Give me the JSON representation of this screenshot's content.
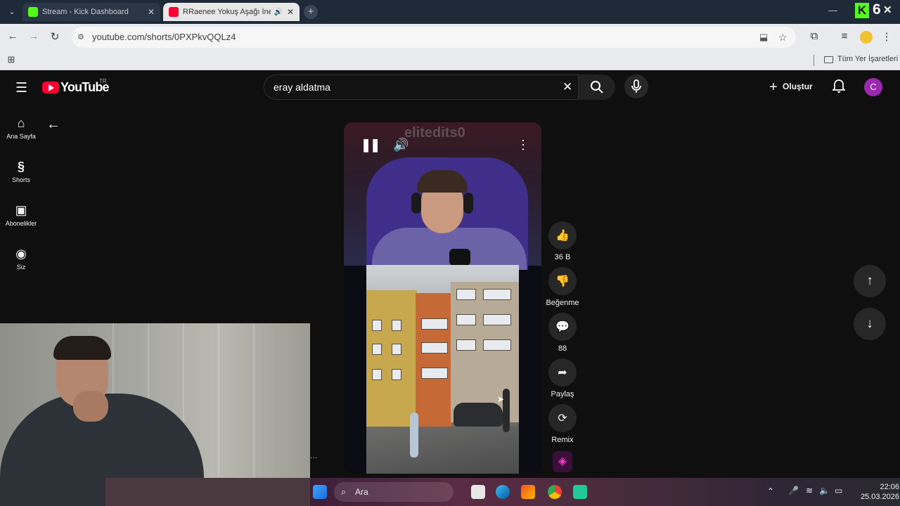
{
  "browser": {
    "tabs": [
      {
        "label": "Stream - Kick Dashboard"
      },
      {
        "label": "RRaenee Yokuş Aşağı İnerk"
      }
    ],
    "url": "youtube.com/shorts/0PXPkvQQLz4",
    "bookmarks_label": "Tüm Yer İşaretleri",
    "overlay_count": "6"
  },
  "youtube": {
    "logo_text": "YouTube",
    "region": "TR",
    "search_value": "eray aldatma",
    "create_label": "Oluştur",
    "avatar_letter": "C",
    "nav": [
      {
        "label": "Ana Sayfa",
        "icon": "home-icon"
      },
      {
        "label": "Shorts",
        "icon": "shorts-icon"
      },
      {
        "label": "Abonelikler",
        "icon": "subscriptions-icon"
      },
      {
        "label": "Siz",
        "icon": "you-icon"
      }
    ],
    "video": {
      "watermark": "elitedits0"
    },
    "actions": {
      "like_count": "36 B",
      "dislike_label": "Beğenme",
      "comment_count": "88",
      "share_label": "Paylaş",
      "remix_label": "Remix"
    }
  },
  "taskbar": {
    "search_label": "Ara",
    "time": "22:06",
    "date": "25.03.2026"
  }
}
